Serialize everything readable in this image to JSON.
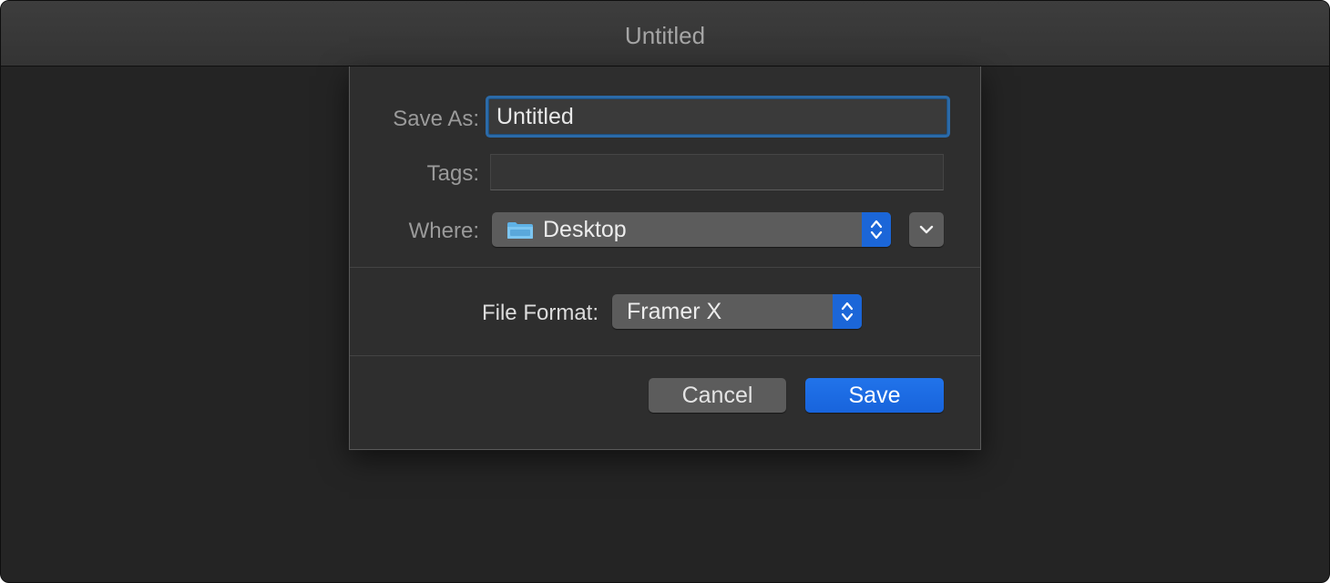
{
  "window": {
    "title": "Untitled"
  },
  "save_dialog": {
    "save_as": {
      "label": "Save As:",
      "value": "Untitled"
    },
    "tags": {
      "label": "Tags:",
      "value": ""
    },
    "where": {
      "label": "Where:",
      "selected": "Desktop",
      "icon": "folder-icon",
      "expand_icon": "chevron-down-icon"
    },
    "file_format": {
      "label": "File Format:",
      "selected": "Framer X"
    },
    "buttons": {
      "cancel_label": "Cancel",
      "save_label": "Save"
    }
  },
  "colors": {
    "accent": "#1b66d8",
    "focus_ring": "#2b6aa8",
    "window_background": "#242424",
    "sheet_background": "#2e2e2e"
  }
}
